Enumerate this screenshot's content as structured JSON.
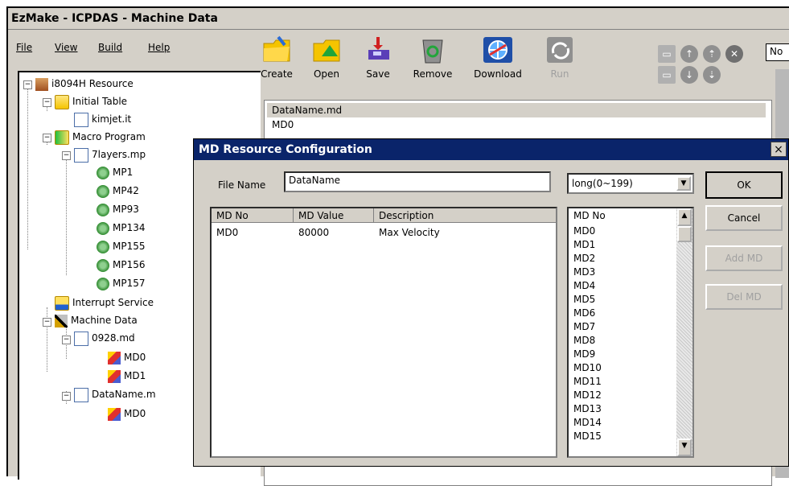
{
  "app": {
    "title": "EzMake - ICPDAS - Machine Data"
  },
  "menu": {
    "items": [
      "File",
      "View",
      "Build",
      "Help"
    ]
  },
  "toolbar": {
    "buttons": [
      {
        "label": "Create",
        "icon": "create-folder-icon",
        "enabled": true
      },
      {
        "label": "Open",
        "icon": "open-folder-icon",
        "enabled": true
      },
      {
        "label": "Save",
        "icon": "save-icon",
        "enabled": true
      },
      {
        "label": "Remove",
        "icon": "recycle-bin-icon",
        "enabled": true
      },
      {
        "label": "Download",
        "icon": "globe-download-icon",
        "enabled": true
      },
      {
        "label": "Run",
        "icon": "run-icon",
        "enabled": false
      }
    ],
    "right_combo_text": "No"
  },
  "tree": {
    "root": "i8094H Resource",
    "initial_table": "Initial Table",
    "kimjet": "kimjet.it",
    "macro_program": "Macro Program",
    "layers_file": "7layers.mp",
    "mp_items": [
      "MP1",
      "MP42",
      "MP93",
      "MP134",
      "MP155",
      "MP156",
      "MP157"
    ],
    "interrupt": "Interrupt Service",
    "machine_data": "Machine Data",
    "md_file_1": "0928.md",
    "md_file_1_items": [
      "MD0",
      "MD1"
    ],
    "md_file_2": "DataName.m",
    "md_file_2_items": [
      "MD0"
    ]
  },
  "content": {
    "header": "DataName.md",
    "first_row": "MD0"
  },
  "dialog": {
    "title": "MD Resource Configuration",
    "close_label": "×",
    "file_name_label": "File Name",
    "file_name_value": "DataName",
    "type_select_value": "long(0~199)",
    "ok_label": "OK",
    "cancel_label": "Cancel",
    "add_md_label": "Add MD",
    "del_md_label": "Del MD",
    "table": {
      "columns": [
        "MD No",
        "MD Value",
        "Description"
      ],
      "rows": [
        [
          "MD0",
          "80000",
          "Max Velocity"
        ]
      ]
    },
    "md_list": {
      "header": "MD No",
      "items": [
        "MD0",
        "MD1",
        "MD2",
        "MD3",
        "MD4",
        "MD5",
        "MD6",
        "MD7",
        "MD8",
        "MD9",
        "MD10",
        "MD11",
        "MD12",
        "MD13",
        "MD14",
        "MD15"
      ]
    }
  }
}
